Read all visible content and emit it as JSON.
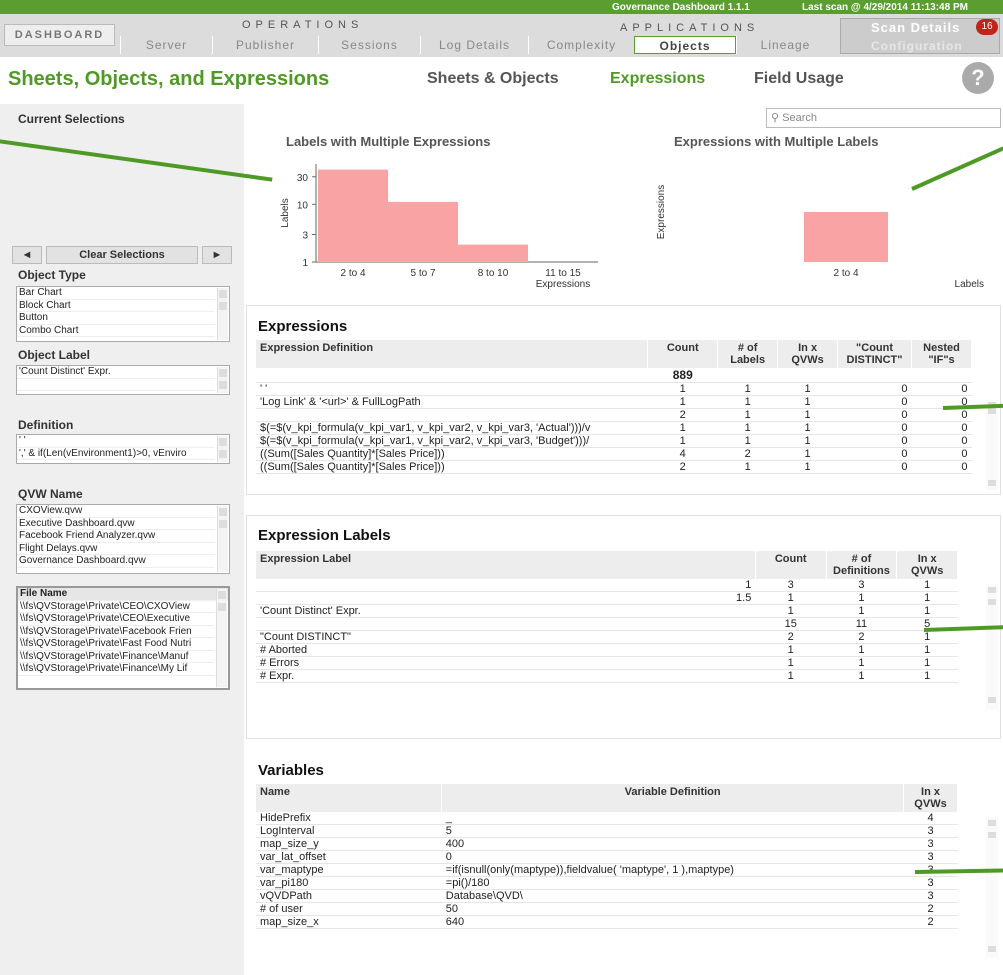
{
  "header": {
    "info_left": "Governance Dashboard 1.1.1",
    "info_right": "Last scan @ 4/29/2014 11:13:48 PM",
    "dashboard": "DASHBOARD",
    "group_operations": "OPERATIONS",
    "group_applications": "APPLICATIONS",
    "tabs": [
      "Server",
      "Publisher",
      "Sessions",
      "Log Details",
      "Complexity",
      "Objects",
      "Lineage"
    ],
    "active_tab": "Objects",
    "scan_details": "Scan Details",
    "scan_count": "16",
    "configuration": "Configuration"
  },
  "page": {
    "title": "Sheets, Objects, and Expressions",
    "subtabs": [
      "Sheets & Objects",
      "Expressions",
      "Field Usage"
    ],
    "help": "?"
  },
  "sidebar": {
    "current_selections": "Current Selections",
    "clear": "Clear Selections",
    "prev": "◄",
    "next": "►",
    "object_type": {
      "label": "Object Type",
      "items": [
        "Bar Chart",
        "Block Chart",
        "Button",
        "Combo Chart"
      ]
    },
    "object_label": {
      "label": "Object Label",
      "items": [
        "'Count Distinct' Expr.",
        ""
      ]
    },
    "definition": {
      "label": "Definition",
      "items": [
        "' '",
        "',' & if(Len(vEnvironment1)>0, vEnviro"
      ]
    },
    "qvw_name": {
      "label": "QVW Name",
      "items": [
        "CXOView.qvw",
        "Executive Dashboard.qvw",
        "Facebook Friend Analyzer.qvw",
        "Flight Delays.qvw",
        "Governance Dashboard.qvw"
      ]
    },
    "file_name": {
      "label": "File Name",
      "items": [
        "\\\\fs\\QVStorage\\Private\\CEO\\CXOView",
        "\\\\fs\\QVStorage\\Private\\CEO\\Executive",
        "\\\\fs\\QVStorage\\Private\\Facebook Frien",
        "\\\\fs\\QVStorage\\Private\\Fast Food Nutri",
        "\\\\fs\\QVStorage\\Private\\Finance\\Manuf",
        "\\\\fs\\QVStorage\\Private\\Finance\\My Lif"
      ]
    }
  },
  "search": {
    "placeholder": "Search"
  },
  "chart_data": [
    {
      "type": "bar",
      "title": "Labels with Multiple Expressions",
      "categories": [
        "2 to 4",
        "5 to 7",
        "8 to 10",
        "11 to 15"
      ],
      "values": [
        40,
        11,
        2,
        1
      ],
      "ylabel": "Labels",
      "xlabel": "Expressions",
      "yticks": [
        "30",
        "10",
        "3",
        "1"
      ],
      "scale": "log"
    },
    {
      "type": "bar",
      "title": "Expressions with Multiple Labels",
      "categories": [
        "2 to 4"
      ],
      "values": [
        1
      ],
      "ylabel": "Expressions",
      "xlabel": "Labels"
    }
  ],
  "expressions": {
    "title": "Expressions",
    "columns": [
      "Expression Definition",
      "Count",
      "# of Labels",
      "In x QVWs",
      "\"Count DISTINCT\"",
      "Nested \"IF\"s"
    ],
    "total": "889",
    "rows": [
      [
        "' '",
        "1",
        "1",
        "1",
        "0",
        "0"
      ],
      [
        "'Log Link' & '<url>' & FullLogPath",
        "1",
        "1",
        "1",
        "0",
        "0"
      ],
      [
        "",
        "2",
        "1",
        "1",
        "0",
        "0"
      ],
      [
        "$(=$(v_kpi_formula(v_kpi_var1, v_kpi_var2, v_kpi_var3, 'Actual')))/v",
        "1",
        "1",
        "1",
        "0",
        "0"
      ],
      [
        "$(=$(v_kpi_formula(v_kpi_var1, v_kpi_var2, v_kpi_var3, 'Budget')))/",
        "1",
        "1",
        "1",
        "0",
        "0"
      ],
      [
        "((Sum([Sales Quantity]*[Sales Price]))",
        "4",
        "2",
        "1",
        "0",
        "0"
      ],
      [
        "((Sum([Sales Quantity]*[Sales Price]))",
        "2",
        "1",
        "1",
        "0",
        "0"
      ]
    ]
  },
  "labels": {
    "title": "Expression Labels",
    "columns": [
      "Expression Label",
      "Count",
      "# of Definitions",
      "In x QVWs"
    ],
    "rows": [
      [
        "1",
        "3",
        "3",
        "1"
      ],
      [
        "1.5",
        "1",
        "1",
        "1"
      ],
      [
        "'Count Distinct' Expr.",
        "1",
        "1",
        "1"
      ],
      [
        "",
        "15",
        "11",
        "5"
      ],
      [
        "\"Count DISTINCT\"",
        "2",
        "2",
        "1"
      ],
      [
        "# Aborted",
        "1",
        "1",
        "1"
      ],
      [
        "# Errors",
        "1",
        "1",
        "1"
      ],
      [
        "# Expr.",
        "1",
        "1",
        "1"
      ]
    ]
  },
  "variables": {
    "title": "Variables",
    "columns": [
      "Name",
      "Variable Definition",
      "In x QVWs"
    ],
    "rows": [
      [
        "HidePrefix",
        "_",
        "4"
      ],
      [
        "LogInterval",
        "5",
        "3"
      ],
      [
        "map_size_y",
        "400",
        "3"
      ],
      [
        "var_lat_offset",
        "0",
        "3"
      ],
      [
        "var_maptype",
        "=if(isnull(only(maptype)),fieldvalue( 'maptype', 1 ),maptype)",
        "3"
      ],
      [
        "var_pi180",
        "=pi()/180",
        "3"
      ],
      [
        "vQVDPath",
        "Database\\QVD\\",
        "3"
      ],
      [
        "# of user",
        "50",
        "2"
      ],
      [
        "map_size_x",
        "640",
        "2"
      ]
    ]
  },
  "colors": {
    "accent": "#4f9a26",
    "bar": "#f9a3a5"
  }
}
